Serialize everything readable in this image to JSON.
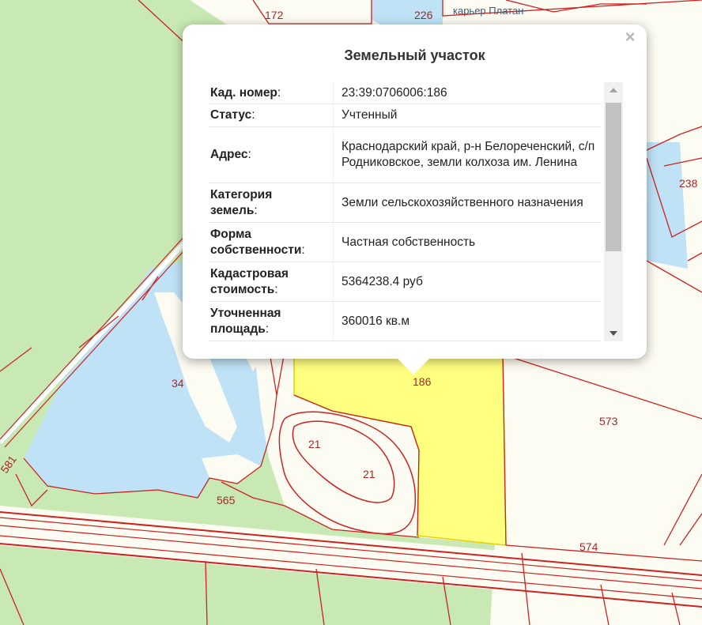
{
  "map": {
    "parcel_labels": [
      "172",
      "226",
      "238",
      "34",
      "186",
      "573",
      "21",
      "21",
      "565",
      "574",
      "581"
    ],
    "place_label": "карьер Платан"
  },
  "popup": {
    "title": "Земельный участок",
    "close_label": "×",
    "rows": [
      {
        "label": "Кад. номер",
        "value": "23:39:0706006:186"
      },
      {
        "label": "Статус",
        "value": "Учтенный"
      },
      {
        "label": "Адрес",
        "value": "Краснодарский край, р-н Белореченский, с/п Родниковское, земли колхоза им. Ленина"
      },
      {
        "label": "Категория земель",
        "value": "Земли сельскохозяйственного назначения"
      },
      {
        "label": "Форма собственности",
        "value": "Частная собственность"
      },
      {
        "label": "Кадастровая стоимость",
        "value": "5364238.4 руб"
      },
      {
        "label": "Уточненная площадь",
        "value": "360016 кв.м"
      }
    ]
  }
}
